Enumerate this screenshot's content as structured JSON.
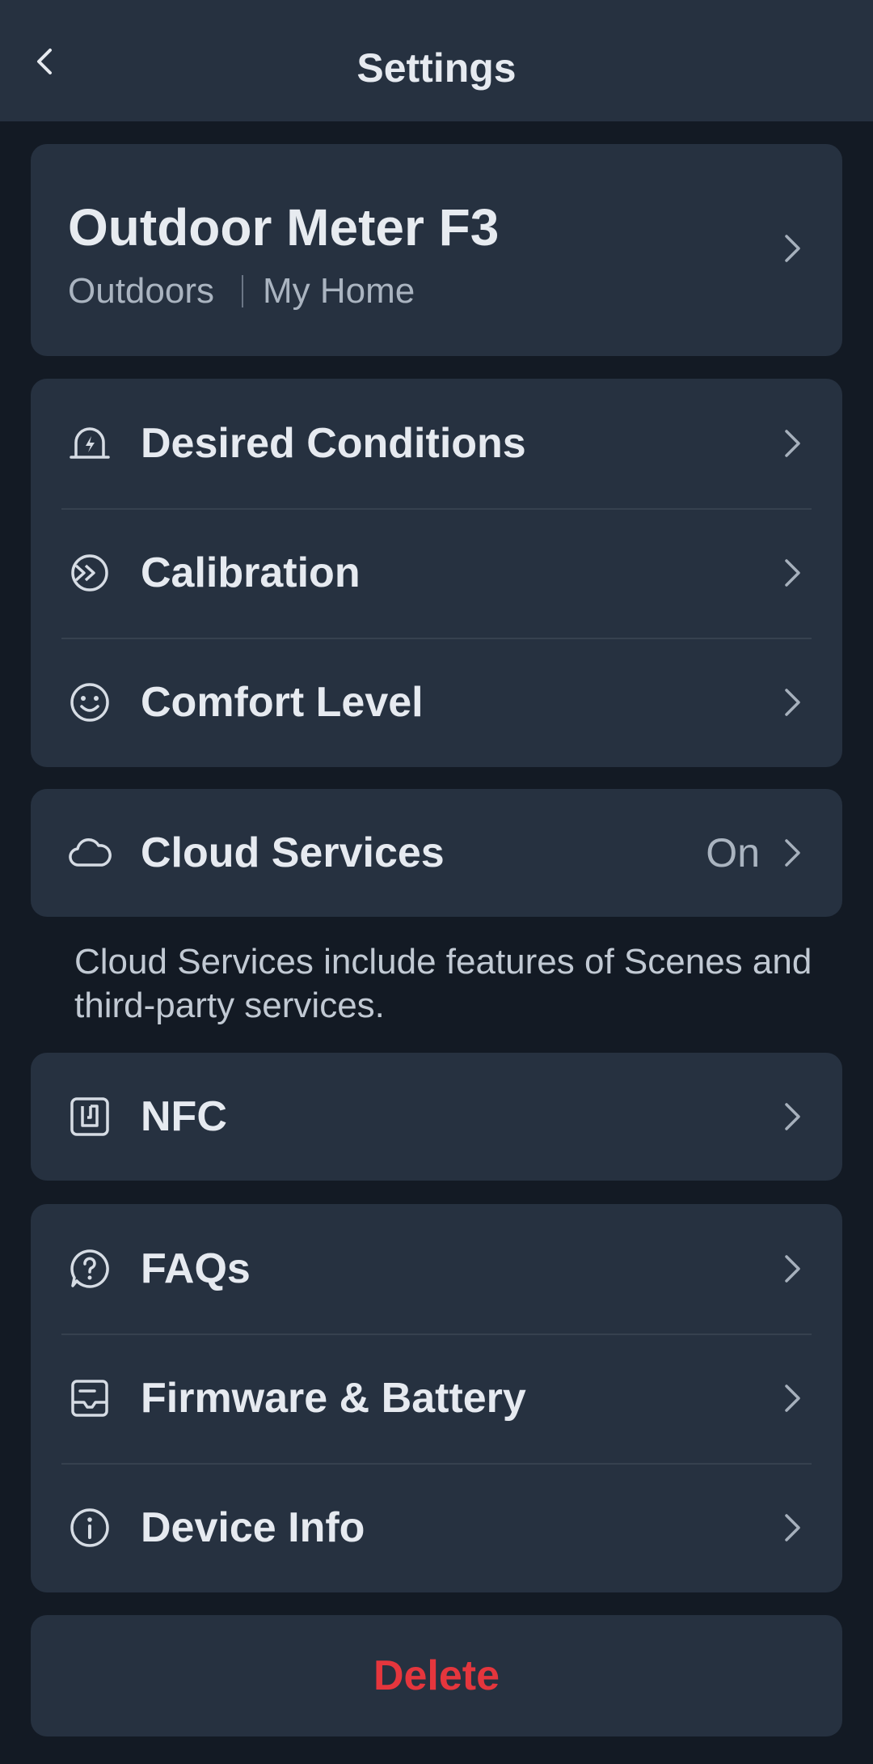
{
  "header": {
    "title": "Settings",
    "back_icon": "chevron-left-icon"
  },
  "device": {
    "name": "Outdoor Meter F3",
    "room": "Outdoors",
    "home": "My Home"
  },
  "group_conditions": [
    {
      "label": "Desired Conditions",
      "icon": "alert-bell-icon"
    },
    {
      "label": "Calibration",
      "icon": "calibration-icon"
    },
    {
      "label": "Comfort Level",
      "icon": "smiley-icon"
    }
  ],
  "cloud": {
    "label": "Cloud Services",
    "value": "On",
    "icon": "cloud-icon",
    "note": "Cloud Services include features of Scenes and third-party services."
  },
  "nfc": {
    "label": "NFC",
    "icon": "nfc-icon"
  },
  "group_support": [
    {
      "label": "FAQs",
      "icon": "question-bubble-icon"
    },
    {
      "label": "Firmware & Battery",
      "icon": "firmware-icon"
    },
    {
      "label": "Device Info",
      "icon": "info-icon"
    }
  ],
  "delete_label": "Delete",
  "colors": {
    "background": "#131a24",
    "card": "#263140",
    "danger": "#e5363d"
  }
}
